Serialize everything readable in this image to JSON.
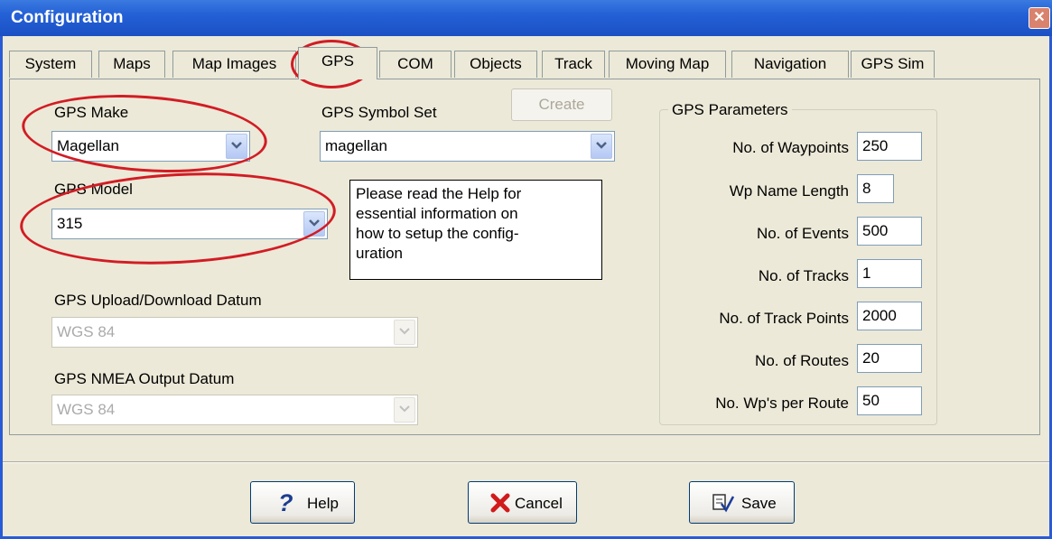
{
  "window": {
    "title": "Configuration",
    "close_glyph": "✕"
  },
  "tabs": [
    "System",
    "Maps",
    "Map Images",
    "GPS",
    "COM",
    "Objects",
    "Track",
    "Moving Map",
    "Navigation",
    "GPS Sim"
  ],
  "active_tab": "GPS",
  "gps": {
    "make_label": "GPS Make",
    "make_value": "Magellan",
    "symbol_set_label": "GPS Symbol Set",
    "symbol_set_value": "magellan",
    "create_label": "Create",
    "model_label": "GPS Model",
    "model_value": "315",
    "note_lines": [
      "Please read the Help for",
      "essential information on",
      "how to setup the config-",
      "uration"
    ],
    "upload_datum_label": "GPS Upload/Download Datum",
    "upload_datum_value": "WGS 84",
    "nmea_datum_label": "GPS NMEA Output Datum",
    "nmea_datum_value": "WGS 84"
  },
  "parameters": {
    "title": "GPS Parameters",
    "rows": [
      {
        "label": "No. of Waypoints",
        "value": "250"
      },
      {
        "label": "Wp Name Length",
        "value": "8"
      },
      {
        "label": "No. of Events",
        "value": "500"
      },
      {
        "label": "No. of Tracks",
        "value": "1"
      },
      {
        "label": "No. of Track Points",
        "value": "2000"
      },
      {
        "label": "No. of Routes",
        "value": "20"
      },
      {
        "label": "No. Wp's per Route",
        "value": "50"
      }
    ]
  },
  "buttons": {
    "help": "Help",
    "cancel": "Cancel",
    "save": "Save"
  },
  "icons": {
    "help": "question-mark-icon",
    "cancel": "red-x-icon",
    "save": "save-check-icon"
  },
  "colors": {
    "titlebar": "#2460d6",
    "annotation": "#d21c24",
    "face": "#ece9d8"
  }
}
